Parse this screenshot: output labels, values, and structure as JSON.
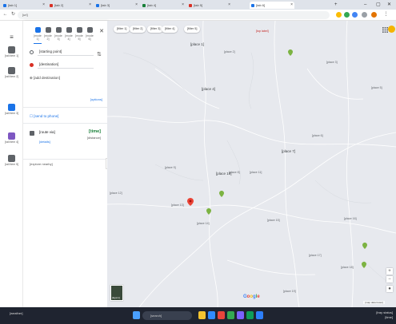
{
  "browser": {
    "tabs": [
      {
        "label": "[tab 1]",
        "color": "#1a73e8"
      },
      {
        "label": "[tab 2]",
        "color": "#d93025"
      },
      {
        "label": "[tab 3]",
        "color": "#1a73e8"
      },
      {
        "label": "[tab 4]",
        "color": "#188038"
      },
      {
        "label": "[tab 5]",
        "color": "#d93025"
      },
      {
        "label": "[tab 6]",
        "color": "#1a73e8",
        "active": true
      }
    ],
    "url": "[url]",
    "new_tab": "+",
    "minimize": "–",
    "maximize": "▢",
    "close": "✕"
  },
  "rail": {
    "items": [
      {
        "label": "[rail item 1]",
        "color": "#5f6368"
      },
      {
        "label": "[rail item 2]",
        "color": "#5f6368"
      },
      {
        "label": "[rail item 3]",
        "color": "#1a73e8"
      },
      {
        "label": "[rail item 4]",
        "color": "#7e57c2"
      },
      {
        "label": "[rail item 5]",
        "color": "#5f6368"
      }
    ]
  },
  "directions": {
    "modes": [
      {
        "label": "[mode 1]",
        "active": true
      },
      {
        "label": "[mode 2]"
      },
      {
        "label": "[mode 3]"
      },
      {
        "label": "[mode 4]"
      },
      {
        "label": "[mode 5]"
      },
      {
        "label": "[mode 6]"
      }
    ],
    "origin": "[starting point]",
    "destination": "[destination]",
    "add_destination": "[add destination]",
    "options": "[options]",
    "send_to_phone": "[send to phone]",
    "route": {
      "via": "[route via]",
      "time": "[time]",
      "distance": "[distance]",
      "details": "[details]"
    },
    "explore": "[explore nearby]"
  },
  "map": {
    "chips": [
      "[filter 1]",
      "[filter 2]",
      "[filter 3]",
      "[filter 4]",
      "[filter 5]"
    ],
    "top_label": "[top label]",
    "labels": [
      {
        "text": "[place 1]",
        "big": true
      },
      {
        "text": "[place 2]"
      },
      {
        "text": "[place 3]"
      },
      {
        "text": "[place 4]",
        "big": true
      },
      {
        "text": "[place 5]"
      },
      {
        "text": "[place 6]"
      },
      {
        "text": "[place 7]",
        "big": true
      },
      {
        "text": "[place 8]"
      },
      {
        "text": "[place 9]"
      },
      {
        "text": "[place 10]",
        "big": true
      },
      {
        "text": "[place 11]"
      },
      {
        "text": "[place 12]"
      },
      {
        "text": "[place 13]"
      },
      {
        "text": "[place 14]"
      },
      {
        "text": "[place 15]"
      },
      {
        "text": "[place 16]"
      },
      {
        "text": "[place 17]"
      },
      {
        "text": "[place 18]"
      },
      {
        "text": "[place 19]"
      }
    ],
    "layers_label": "[layers]",
    "zoom_in": "+",
    "zoom_out": "−",
    "logo": "Google",
    "footer": "[map data footer]"
  },
  "taskbar": {
    "weather": "[weather]",
    "search": "[search]",
    "tray": "[tray status]",
    "clock": "[time]"
  }
}
